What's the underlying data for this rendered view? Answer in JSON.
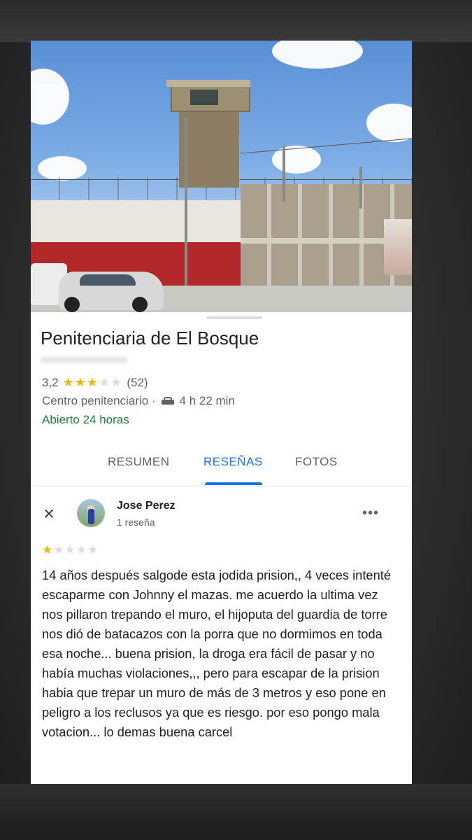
{
  "place": {
    "name": "Penitenciaria de El Bosque",
    "rating": "3,2",
    "rating_value": 3.2,
    "stars": "★★★",
    "stars_off": "★★",
    "review_count": "(52)",
    "category": "Centro penitenciario ·",
    "travel_time": "4 h 22 min",
    "hours": "Abierto 24 horas"
  },
  "tabs": [
    {
      "label": "RESUMEN",
      "active": false
    },
    {
      "label": "RESEÑAS",
      "active": true
    },
    {
      "label": "FOTOS",
      "active": false
    }
  ],
  "review": {
    "author": "Jose Perez",
    "author_reviews": "1 reseña",
    "rating": 1,
    "stars_on": "★",
    "stars_off": "★★★★",
    "text": "14 años después salgode esta jodida prision,, 4 veces intenté escaparme con Johnny el mazas. me acuerdo la ultima vez nos pillaron trepando el muro, el hijoputa del guardia de torre nos dió de batacazos con la porra que no dormimos en toda esa noche... buena prision, la droga era fácil de pasar y no había muchas violaciones,,, pero para escapar de la prision habia que trepar un muro de más de 3 metros y eso pone en peligro a los reclusos ya que es riesgo.  por eso pongo mala votacion... lo demas buena carcel"
  },
  "icons": {
    "close": "×",
    "more": "•••",
    "car": "car-icon"
  },
  "colors": {
    "accent": "#1a73e8",
    "star": "#f4b400",
    "open": "#188038"
  }
}
